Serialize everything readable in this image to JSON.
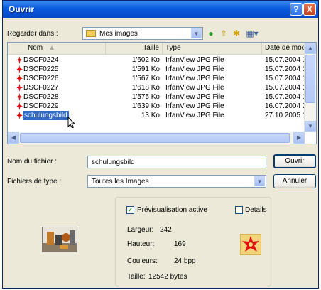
{
  "window": {
    "title": "Ouvrir",
    "help_label": "?",
    "close_label": "X"
  },
  "lookin": {
    "label": "Regarder dans :",
    "value": "Mes images"
  },
  "columns": [
    "Nom",
    "Taille",
    "Type",
    "Date de mod"
  ],
  "files": [
    {
      "name": "DSCF0224",
      "size": "1'602 Ko",
      "type": "IrfanView JPG File",
      "date": "15.07.2004 1"
    },
    {
      "name": "DSCF0225",
      "size": "1'591 Ko",
      "type": "IrfanView JPG File",
      "date": "15.07.2004 1"
    },
    {
      "name": "DSCF0226",
      "size": "1'567 Ko",
      "type": "IrfanView JPG File",
      "date": "15.07.2004 1"
    },
    {
      "name": "DSCF0227",
      "size": "1'618 Ko",
      "type": "IrfanView JPG File",
      "date": "15.07.2004 1"
    },
    {
      "name": "DSCF0228",
      "size": "1'575 Ko",
      "type": "IrfanView JPG File",
      "date": "15.07.2004 1"
    },
    {
      "name": "DSCF0229",
      "size": "1'639 Ko",
      "type": "IrfanView JPG File",
      "date": "16.07.2004 2"
    },
    {
      "name": "schulungsbild",
      "size": "13 Ko",
      "type": "IrfanView JPG File",
      "date": "27.10.2005 1"
    }
  ],
  "filename": {
    "label": "Nom du fichier :",
    "value": "schulungsbild"
  },
  "filetype": {
    "label": "Fichiers de type :",
    "value": "Toutes les Images"
  },
  "buttons": {
    "open": "Ouvrir",
    "cancel": "Annuler"
  },
  "preview": {
    "active_label": "Prévisualisation active",
    "details_label": "Details",
    "width_label": "Largeur:",
    "width_value": "242",
    "height_label": "Hauteur:",
    "height_value": "169",
    "colors_label": "Couleurs:",
    "colors_value": "24 bpp",
    "size_label": "Taille:",
    "size_value": "12542 bytes"
  },
  "colors": {
    "titlebar": "#0A5BDF",
    "dialog_bg": "#ECE9D8",
    "selection": "#316AC5",
    "file_icon": "#E01010"
  },
  "icons": [
    "folder-icon",
    "back-icon",
    "up-folder-icon",
    "new-folder-icon",
    "view-menu-icon",
    "jpg-file-icon",
    "mouse-cursor-icon"
  ]
}
